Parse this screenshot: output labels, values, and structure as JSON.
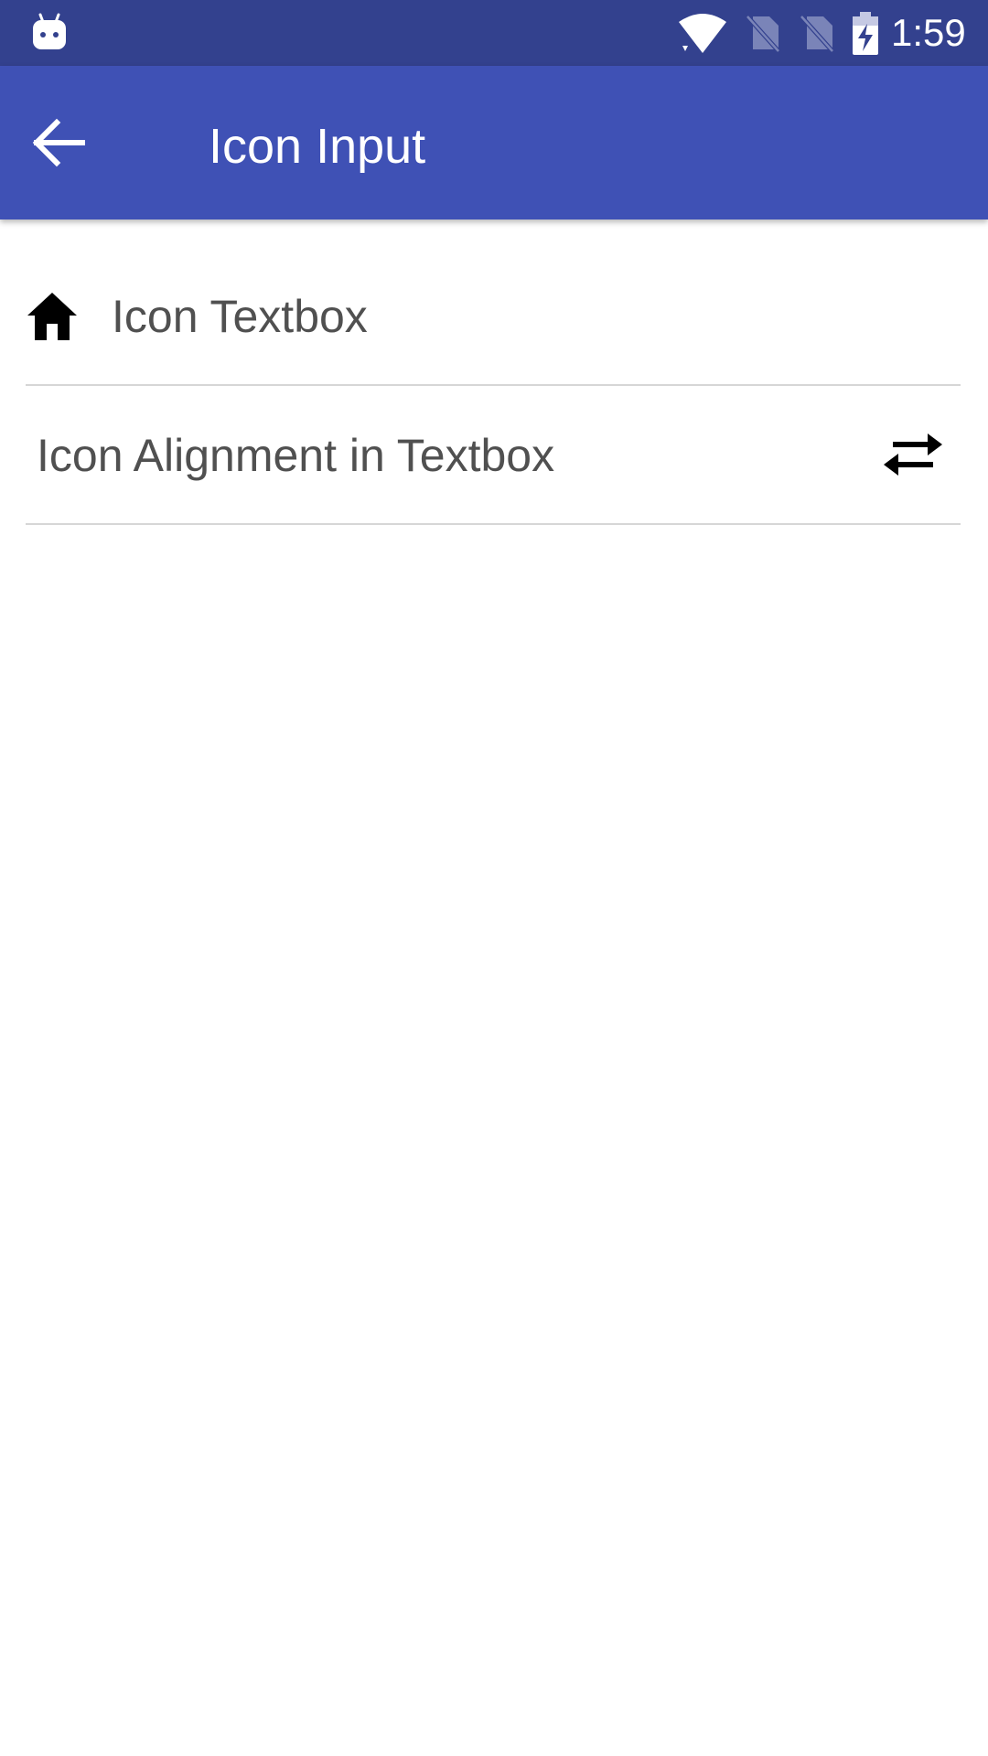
{
  "status_bar": {
    "time": "1:59",
    "icons": [
      "android-notification-icon",
      "wifi-icon",
      "no-sim-icon",
      "no-sim-icon",
      "battery-charging-icon"
    ]
  },
  "app_bar": {
    "title": "Icon Input",
    "back_icon": "arrow-back-icon",
    "background_color": "#3f51b5",
    "status_bar_color": "#33418e"
  },
  "fields": [
    {
      "text": "Icon Textbox",
      "leading_icon": "home-icon"
    },
    {
      "text": "Icon Alignment in Textbox",
      "trailing_icon": "swap-horiz-icon"
    }
  ]
}
